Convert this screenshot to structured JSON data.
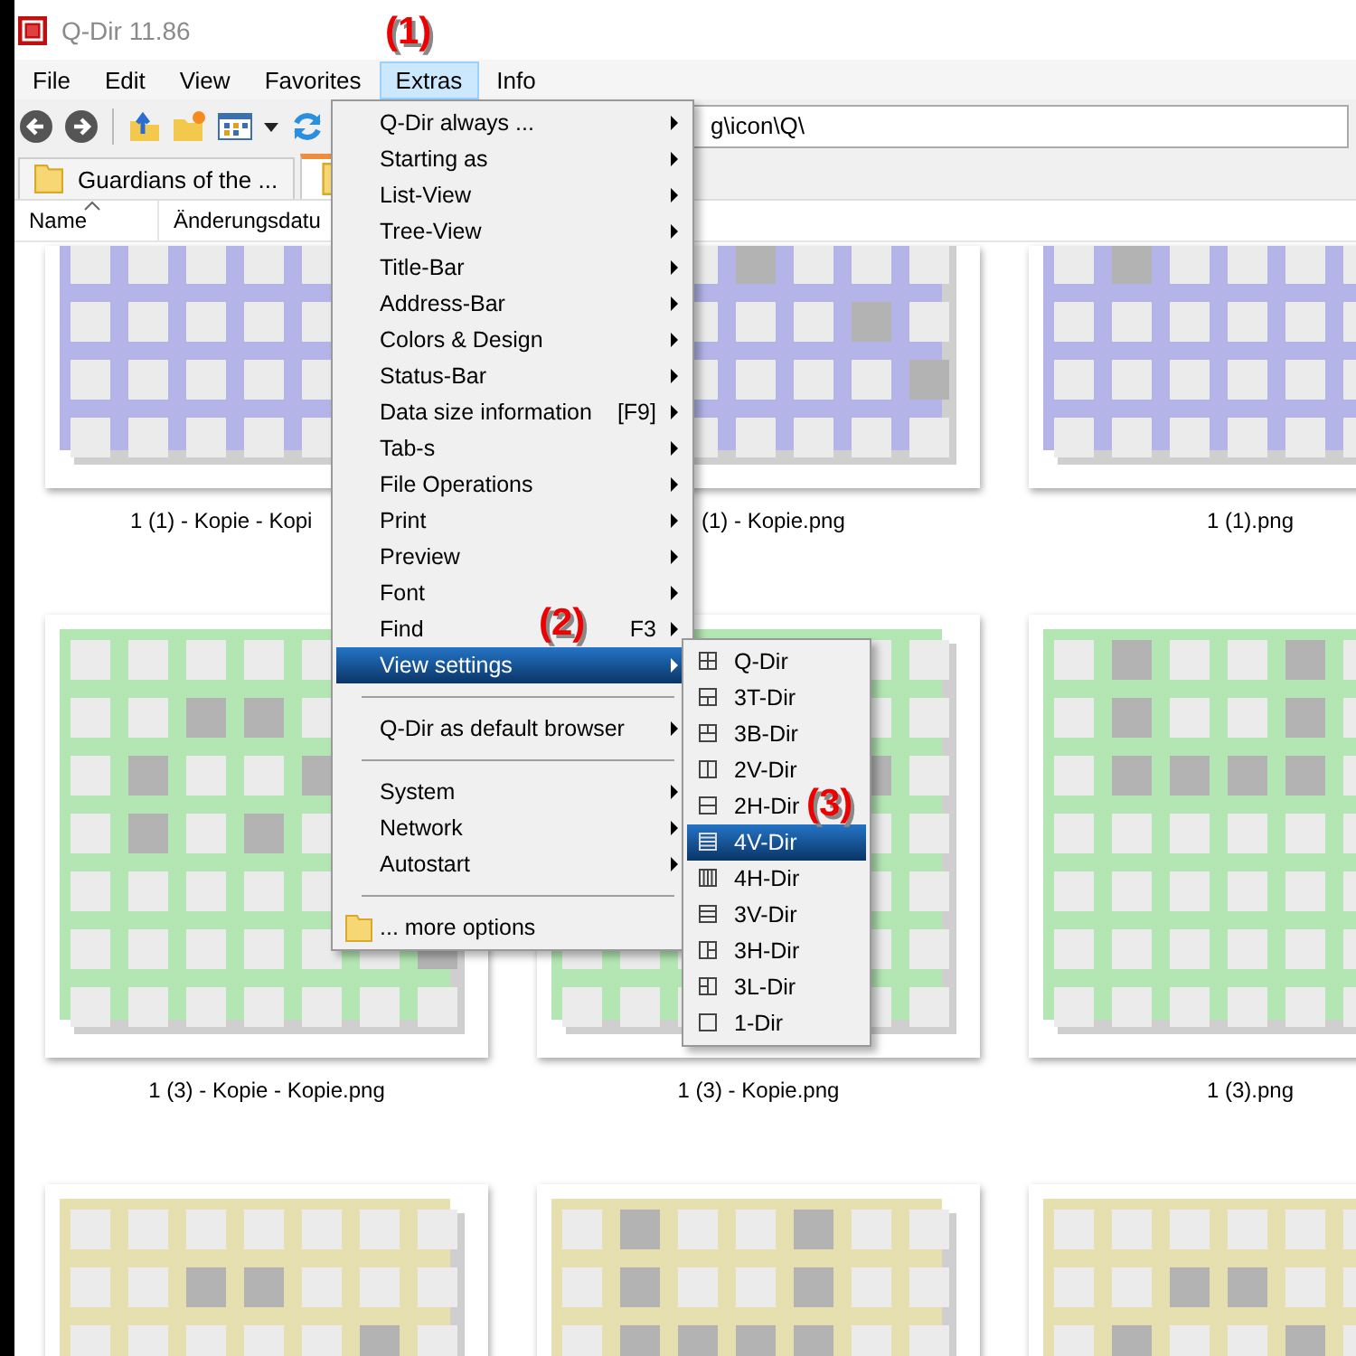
{
  "window": {
    "title": "Q-Dir 11.86"
  },
  "menu_bar": [
    {
      "label": "File",
      "selected": false
    },
    {
      "label": "Edit",
      "selected": false
    },
    {
      "label": "View",
      "selected": false
    },
    {
      "label": "Favorites",
      "selected": false
    },
    {
      "label": "Extras",
      "selected": true
    },
    {
      "label": "Info",
      "selected": false
    }
  ],
  "address_bar": {
    "value": "g\\icon\\Q\\"
  },
  "tabs": [
    {
      "label": "Guardians of the ...",
      "selected": false
    },
    {
      "selected": true
    }
  ],
  "columns": [
    {
      "label": "Name",
      "sorted": true
    },
    {
      "label": "Änderungsdatu",
      "sorted": false
    }
  ],
  "files": [
    {
      "name": "1 (1) - Kopie - Kopi",
      "thumbnail": {
        "kind": "picture"
      }
    },
    {
      "name": "(1) - Kopie.png",
      "thumbnail": {
        "kind": "picture"
      }
    },
    {
      "name": "1 (1).png",
      "thumbnail": {
        "kind": "picture"
      }
    },
    {
      "name": "1 (3) - Kopie - Kopie.png",
      "thumbnail": {
        "kind": "picture"
      }
    },
    {
      "name": "1 (3) - Kopie.png",
      "thumbnail": {
        "kind": "picture"
      }
    },
    {
      "name": "1 (3).png",
      "thumbnail": {
        "kind": "picture"
      }
    },
    {
      "thumbnail": {
        "kind": "picture"
      }
    },
    {
      "thumbnail": {
        "kind": "picture"
      }
    },
    {
      "thumbnail": {
        "kind": "picture"
      }
    }
  ],
  "menu": {
    "items": [
      {
        "kind": "item",
        "label": "Q-Dir always ...",
        "submenu": true,
        "selected": false
      },
      {
        "kind": "item",
        "label": "Starting as",
        "submenu": true,
        "selected": false
      },
      {
        "kind": "item",
        "label": "List-View",
        "submenu": true,
        "selected": false
      },
      {
        "kind": "item",
        "label": "Tree-View",
        "submenu": true,
        "selected": false
      },
      {
        "kind": "item",
        "label": "Title-Bar",
        "submenu": true,
        "selected": false
      },
      {
        "kind": "item",
        "label": "Address-Bar",
        "submenu": true,
        "selected": false
      },
      {
        "kind": "item",
        "label": "Colors & Design",
        "submenu": true,
        "selected": false
      },
      {
        "kind": "item",
        "label": "Status-Bar",
        "submenu": true,
        "selected": false
      },
      {
        "kind": "item",
        "label": "Data size information",
        "shortcut": "[F9]",
        "submenu": true,
        "selected": false
      },
      {
        "kind": "item",
        "label": "Tab-s",
        "submenu": true,
        "selected": false
      },
      {
        "kind": "item",
        "label": "File Operations",
        "submenu": true,
        "selected": false
      },
      {
        "kind": "item",
        "label": "Print",
        "submenu": true,
        "selected": false
      },
      {
        "kind": "item",
        "label": "Preview",
        "submenu": true,
        "selected": false
      },
      {
        "kind": "item",
        "label": "Font",
        "submenu": true,
        "selected": false
      },
      {
        "kind": "item",
        "label": "Find",
        "shortcut": "F3",
        "submenu": true,
        "selected": false
      },
      {
        "kind": "item",
        "label": "View settings",
        "submenu": true,
        "selected": true
      },
      {
        "kind": "separator"
      },
      {
        "kind": "item",
        "label": "Q-Dir as default browser",
        "submenu": true,
        "selected": false
      },
      {
        "kind": "separator"
      },
      {
        "kind": "item",
        "label": "System",
        "submenu": true,
        "selected": false
      },
      {
        "kind": "item",
        "label": "Network",
        "submenu": true,
        "selected": false
      },
      {
        "kind": "item",
        "label": "Autostart",
        "submenu": true,
        "selected": false
      },
      {
        "kind": "separator"
      },
      {
        "kind": "folder-item",
        "label": "... more options",
        "submenu": false,
        "selected": false
      }
    ]
  },
  "submenu": {
    "items": [
      {
        "label": "Q-Dir",
        "selected": false
      },
      {
        "label": "3T-Dir",
        "selected": false
      },
      {
        "label": "3B-Dir",
        "selected": false
      },
      {
        "label": "2V-Dir",
        "selected": false
      },
      {
        "label": "2H-Dir",
        "selected": false
      },
      {
        "label": "4V-Dir",
        "selected": true
      },
      {
        "label": "4H-Dir",
        "selected": false
      },
      {
        "label": "3V-Dir",
        "selected": false
      },
      {
        "label": "3H-Dir",
        "selected": false
      },
      {
        "label": "3L-Dir",
        "selected": false
      },
      {
        "label": "1-Dir",
        "selected": false
      }
    ]
  },
  "annotations": [
    {
      "label": "(1)"
    },
    {
      "label": "(2)"
    },
    {
      "label": "(3)"
    }
  ]
}
